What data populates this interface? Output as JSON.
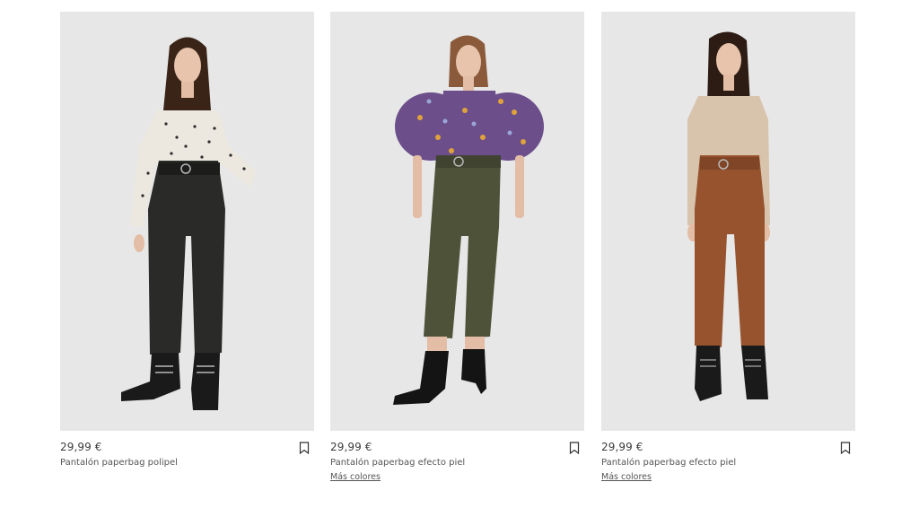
{
  "colors": {
    "photo_background": "#e7e7e7",
    "text_primary": "#3d3d3d",
    "text_secondary": "#555555"
  },
  "products": [
    {
      "price": "29,99 €",
      "name": "Pantalón paperbag polipel",
      "more_colors": "",
      "bookmark_icon": "bookmark-icon",
      "pants_color": "#2a2b29",
      "top_color": "#ece8df"
    },
    {
      "price": "29,99 €",
      "name": "Pantalón paperbag efecto piel",
      "more_colors": "Más colores",
      "bookmark_icon": "bookmark-icon",
      "pants_color": "#4e5239",
      "top_color": "#6b4e8a"
    },
    {
      "price": "29,99 €",
      "name": "Pantalón paperbag efecto piel",
      "more_colors": "Más colores",
      "bookmark_icon": "bookmark-icon",
      "pants_color": "#96532e",
      "top_color": "#d8c3ad"
    }
  ]
}
